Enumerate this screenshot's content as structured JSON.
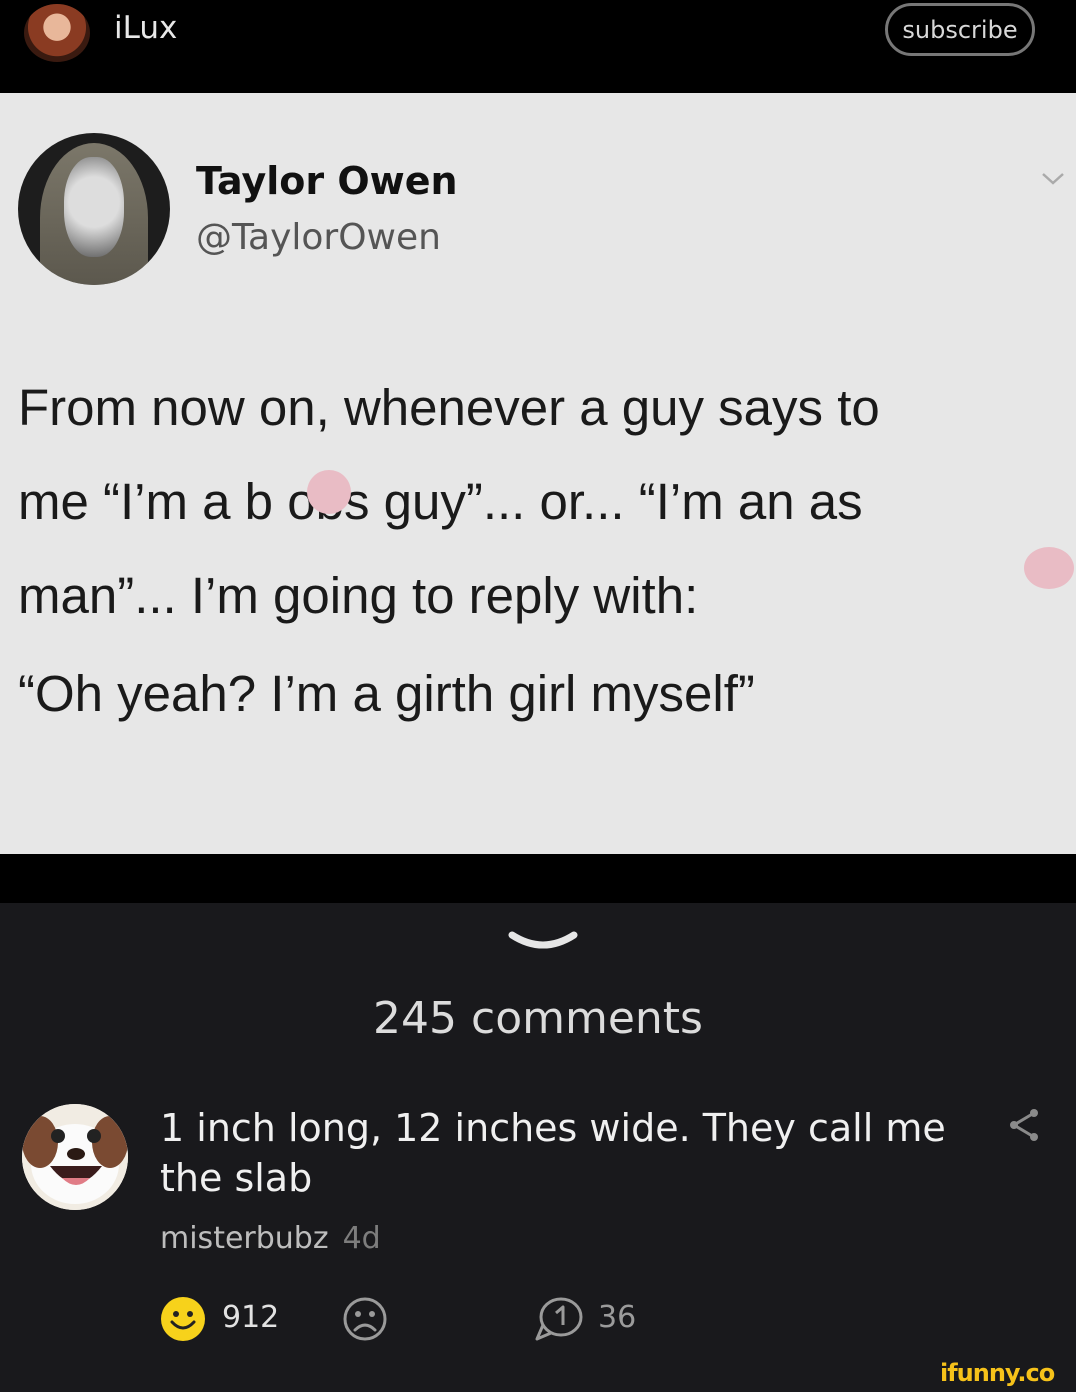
{
  "header": {
    "channel_name": "iLux",
    "subscribe_label": "subscribe"
  },
  "tweet": {
    "author_name": "Taylor Owen",
    "author_handle": "@TaylorOwen",
    "lines": [
      "From now on, whenever a guy says to",
      "me “I’m a b  obs guy”... or... “I’m an as",
      "man”... I’m going to reply with:",
      "“Oh yeah? I’m a girth girl myself”"
    ]
  },
  "comments": {
    "count_label": "245 comments",
    "items": [
      {
        "text": "1 inch long, 12 inches wide. They call me the slab",
        "username": "misterbubz",
        "time": "4d",
        "likes": "912",
        "replies": "36"
      }
    ]
  },
  "watermark": "ifunny.co",
  "colors": {
    "background": "#000000",
    "comments_bg": "#19191c",
    "smile_active": "#f7d21b",
    "tweet_bg": "#e7e7e7"
  }
}
